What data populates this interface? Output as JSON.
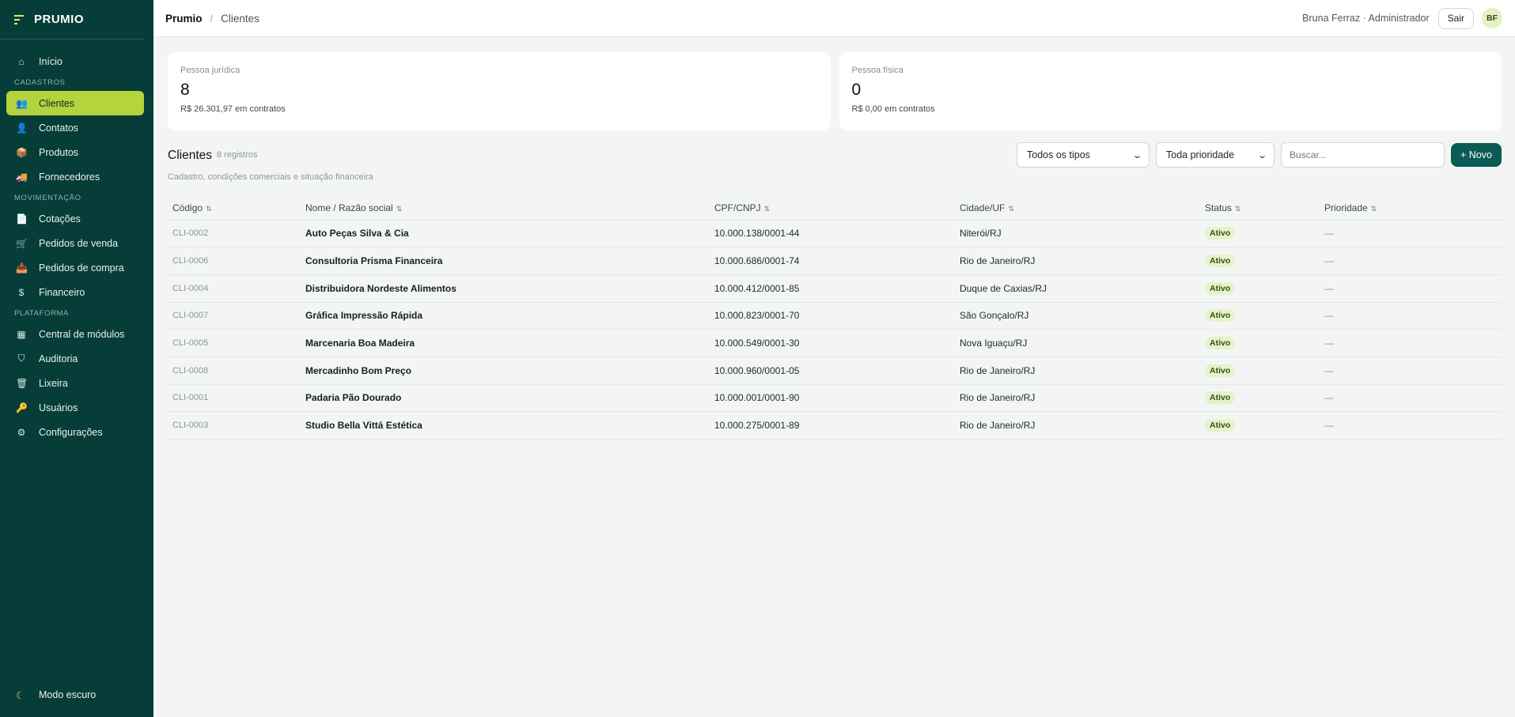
{
  "brand": {
    "name": "PRUMIO"
  },
  "sidebar": {
    "home": {
      "label": "Início",
      "icon": "home-icon"
    },
    "sections": [
      {
        "title": "CADASTROS",
        "items": [
          {
            "label": "Clientes",
            "icon": "users-icon",
            "glyph": "👥",
            "active": true
          },
          {
            "label": "Contatos",
            "icon": "contact-icon",
            "glyph": "👤"
          },
          {
            "label": "Produtos",
            "icon": "box-icon",
            "glyph": "📦"
          },
          {
            "label": "Fornecedores",
            "icon": "truck-icon",
            "glyph": "🚚"
          }
        ]
      },
      {
        "title": "MOVIMENTAÇÃO",
        "items": [
          {
            "label": "Cotações",
            "icon": "document-icon",
            "glyph": "📄"
          },
          {
            "label": "Pedidos de venda",
            "icon": "cart-icon",
            "glyph": "🛒"
          },
          {
            "label": "Pedidos de compra",
            "icon": "purchase-icon",
            "glyph": "📥"
          },
          {
            "label": "Financeiro",
            "icon": "dollar-icon",
            "glyph": "$"
          }
        ]
      },
      {
        "title": "PLATAFORMA",
        "items": [
          {
            "label": "Central de módulos",
            "icon": "grid-icon",
            "glyph": "▦"
          },
          {
            "label": "Auditoria",
            "icon": "shield-icon",
            "glyph": "⛉"
          },
          {
            "label": "Lixeira",
            "icon": "trash-icon",
            "glyph": "🗑"
          },
          {
            "label": "Usuários",
            "icon": "key-icon",
            "glyph": "🔑"
          },
          {
            "label": "Configurações",
            "icon": "gear-icon",
            "glyph": "⚙"
          }
        ]
      }
    ],
    "dark_mode_label": "Modo escuro"
  },
  "topbar": {
    "breadcrumb_root": "Prumio",
    "breadcrumb_sep": "/",
    "breadcrumb_current": "Clientes",
    "user": "Bruna Ferraz · Administrador",
    "logout_label": "Sair",
    "avatar_initials": "BF"
  },
  "cards": [
    {
      "label": "Pessoa jurídica",
      "value": "8",
      "sub": "R$ 26.301,97 em contratos"
    },
    {
      "label": "Pessoa física",
      "value": "0",
      "sub": "R$ 0,00 em contratos"
    }
  ],
  "list": {
    "title": "Clientes",
    "count": "8 registros",
    "description": "Cadastro, condições comerciais e situação financeira",
    "filter_type": "Todos os tipos",
    "filter_priority": "Toda prioridade",
    "search_placeholder": "Buscar...",
    "new_label": "+ Novo"
  },
  "table": {
    "columns": [
      "Código",
      "Nome / Razão social",
      "CPF/CNPJ",
      "Cidade/UF",
      "Status",
      "Prioridade"
    ],
    "rows": [
      {
        "code": "CLI-0002",
        "name": "Auto Peças Silva & Cia",
        "doc": "10.000.138/0001-44",
        "city": "Niterói/RJ",
        "status": "Ativo",
        "priority": "—"
      },
      {
        "code": "CLI-0006",
        "name": "Consultoria Prisma Financeira",
        "doc": "10.000.686/0001-74",
        "city": "Rio de Janeiro/RJ",
        "status": "Ativo",
        "priority": "—"
      },
      {
        "code": "CLI-0004",
        "name": "Distribuidora Nordeste Alimentos",
        "doc": "10.000.412/0001-85",
        "city": "Duque de Caxias/RJ",
        "status": "Ativo",
        "priority": "—"
      },
      {
        "code": "CLI-0007",
        "name": "Gráfica Impressão Rápida",
        "doc": "10.000.823/0001-70",
        "city": "São Gonçalo/RJ",
        "status": "Ativo",
        "priority": "—"
      },
      {
        "code": "CLI-0005",
        "name": "Marcenaria Boa Madeira",
        "doc": "10.000.549/0001-30",
        "city": "Nova Iguaçu/RJ",
        "status": "Ativo",
        "priority": "—"
      },
      {
        "code": "CLI-0008",
        "name": "Mercadinho Bom Preço",
        "doc": "10.000.960/0001-05",
        "city": "Rio de Janeiro/RJ",
        "status": "Ativo",
        "priority": "—"
      },
      {
        "code": "CLI-0001",
        "name": "Padaria Pão Dourado",
        "doc": "10.000.001/0001-90",
        "city": "Rio de Janeiro/RJ",
        "status": "Ativo",
        "priority": "—"
      },
      {
        "code": "CLI-0003",
        "name": "Studio Bella Vittá Estética",
        "doc": "10.000.275/0001-89",
        "city": "Rio de Janeiro/RJ",
        "status": "Ativo",
        "priority": "—"
      }
    ]
  }
}
